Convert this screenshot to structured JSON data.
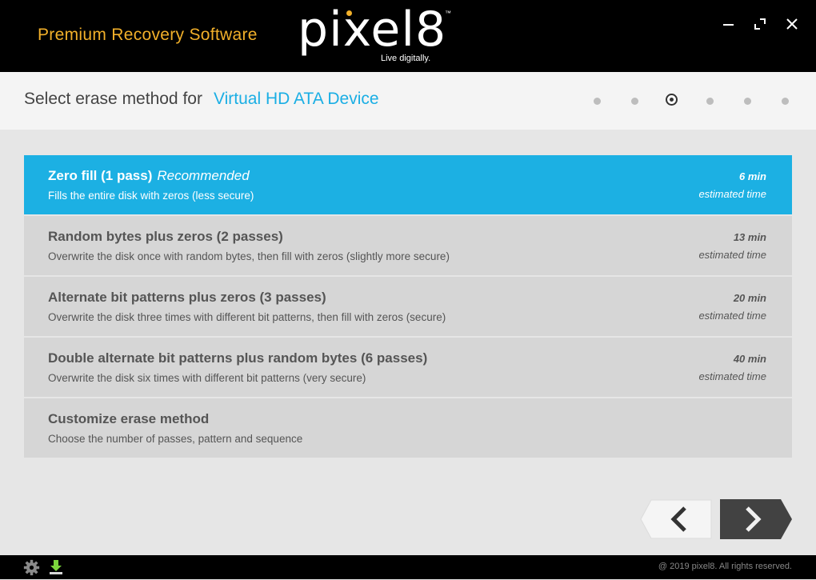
{
  "titlebar": {
    "tagline": "Premium Recovery Software",
    "logo_text": "pixel8",
    "logo_trademark": "™",
    "logo_subtitle": "Live digitally.",
    "controls": [
      "minimize-icon",
      "maximize-icon",
      "close-icon"
    ]
  },
  "header": {
    "prefix": "Select erase method for",
    "device": "Virtual HD ATA Device",
    "steps": {
      "total": 6,
      "current": 3
    }
  },
  "options": [
    {
      "title": "Zero fill (1 pass)",
      "badge": "Recommended",
      "description": "Fills the entire disk with zeros (less secure)",
      "time": "6 min",
      "time_label": "estimated time",
      "selected": true
    },
    {
      "title": "Random bytes plus zeros (2 passes)",
      "description": "Overwrite the disk once with random bytes, then fill with zeros (slightly more secure)",
      "time": "13 min",
      "time_label": "estimated time"
    },
    {
      "title": "Alternate bit patterns plus zeros (3 passes)",
      "description": "Overwrite the disk three times with different bit patterns, then fill with zeros (secure)",
      "time": "20 min",
      "time_label": "estimated time"
    },
    {
      "title": "Double alternate bit patterns plus random bytes (6 passes)",
      "description": "Overwrite the disk six times with different bit patterns (very secure)",
      "time": "40 min",
      "time_label": "estimated time"
    },
    {
      "title": "Customize erase method",
      "description": "Choose the number of passes, pattern and sequence"
    }
  ],
  "navigation": {
    "back_icon": "chevron-left-icon",
    "next_icon": "chevron-right-icon"
  },
  "footer": {
    "icons": [
      "gear-icon",
      "download-icon"
    ],
    "copyright": "@ 2019 pixel8. All rights reserved."
  },
  "colors": {
    "accent": "#1cb0e3",
    "brand_yellow": "#f2b02a",
    "next_button": "#424242",
    "titlebar": "#000000"
  }
}
